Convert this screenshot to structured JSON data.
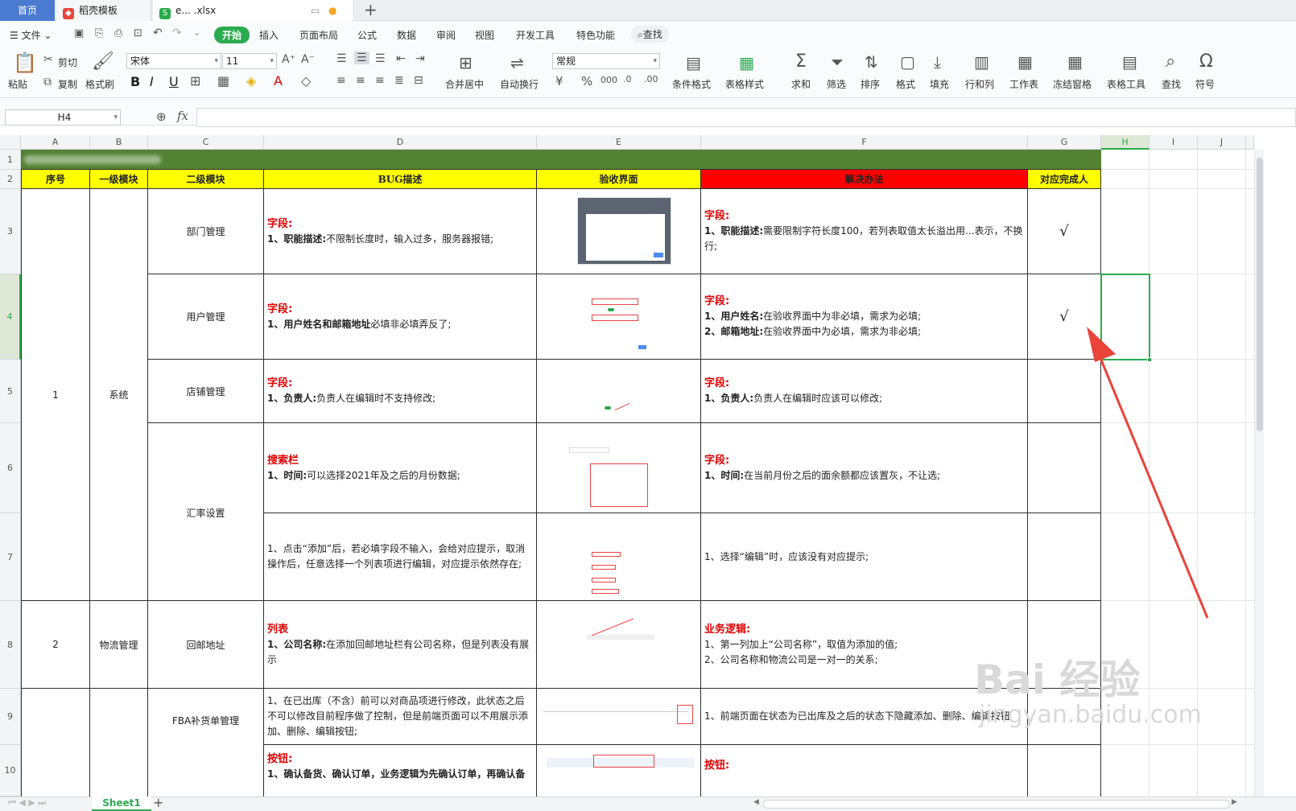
{
  "tabs": {
    "home": "首页",
    "template": "稻壳模板",
    "file": "e... .xlsx"
  },
  "menu": [
    "文件",
    "开始",
    "插入",
    "页面布局",
    "公式",
    "数据",
    "审阅",
    "视图",
    "开发工具",
    "特色功能",
    "查找"
  ],
  "ribbon": {
    "paste": "粘贴",
    "cut": "剪切",
    "copy": "复制",
    "format_painter": "格式刷",
    "font_name": "宋体",
    "font_size": "11",
    "merge": "合并居中",
    "wrap": "自动换行",
    "number_format": "常规",
    "cond_format": "条件格式",
    "table_style": "表格样式",
    "sum": "求和",
    "filter": "筛选",
    "sort": "排序",
    "format": "格式",
    "fill": "填充",
    "rowcol": "行和列",
    "worksheet": "工作表",
    "freeze": "冻结窗格",
    "table_tools": "表格工具",
    "find": "查找",
    "symbol": "符号"
  },
  "formula_bar": {
    "cell_ref": "H4",
    "fx": "fx",
    "value": ""
  },
  "columns": [
    "A",
    "B",
    "C",
    "D",
    "E",
    "F",
    "G",
    "H",
    "I",
    "J"
  ],
  "rows": [
    "1",
    "2",
    "3",
    "4",
    "5",
    "6",
    "7",
    "8",
    "9",
    "10"
  ],
  "sheet": {
    "headers": [
      "序号",
      "一级模块",
      "二级模块",
      "BUG描述",
      "验收界面",
      "解决办法",
      "对应完成人"
    ],
    "a_group1": "1",
    "b_group1": "系统",
    "a_group2": "2",
    "b_group2": "物流管理",
    "c3": "部门管理",
    "c4": "用户管理",
    "c5": "店铺管理",
    "c6": "汇率设置",
    "c8": "回邮地址",
    "c9": "FBA补货单管理",
    "d3_title": "字段:",
    "d3_key": "1、职能描述:",
    "d3_text": "不限制长度时，输入过多，服务器报错;",
    "f3_title": "字段:",
    "f3_key": "1、职能描述:",
    "f3_text": "需要限制字符长度100，若列表取值太长溢出用...表示，不换行;",
    "d4_title": "字段:",
    "d4_key": "1、用户姓名和邮箱地址",
    "d4_text": "必填非必填弄反了;",
    "f4_title": "字段:",
    "f4_key1": "1、用户姓名:",
    "f4_text1": "在验收界面中为非必填，需求为必填;",
    "f4_key2": "2、邮箱地址:",
    "f4_text2": "在验收界面中为必填，需求为非必填;",
    "d5_title": "字段:",
    "d5_key": "1、负责人:",
    "d5_text": "负责人在编辑时不支持修改;",
    "f5_title": "字段:",
    "f5_key": "1、负责人:",
    "f5_text": "负责人在编辑时应该可以修改;",
    "d6_title": "搜索栏",
    "d6_key": "1、时间:",
    "d6_text": "可以选择2021年及之后的月份数据;",
    "f6_title": "字段:",
    "f6_key": "1、时间:",
    "f6_text": "在当前月份之后的面余额都应该置灰，不让选;",
    "d7_text": "1、点击“添加”后，若必填字段不输入，会给对应提示，取消操作后，任意选择一个列表项进行编辑，对应提示依然存在;",
    "f7_text": "1、选择“编辑”时，应该没有对应提示;",
    "d8_title": "列表",
    "d8_key": "1、公司名称:",
    "d8_text": "在添加回邮地址栏有公司名称，但是列表没有展示",
    "f8_title": "业务逻辑:",
    "f8_text1": "1、第一列加上“公司名称”，取值为添加的值;",
    "f8_text2": "2、公司名称和物流公司是一对一的关系;",
    "d9_text": "1、在已出库（不含）前可以对商品项进行修改，此状态之后不可以修改目前程序做了控制，但是前端页面可以不用展示添加、删除、编辑按钮;",
    "f9_text": "1、前端页面在状态为已出库及之后的状态下隐藏添加、删除、编辑按钮",
    "d10_title": "按钮:",
    "d10_text": "1、确认备货、确认订单，业务逻辑为先确认订单，再确认备",
    "f10_title": "按钮:",
    "check_mark": "√"
  },
  "sheet_tab": "Sheet1",
  "watermark": {
    "line1": "Bai 经验",
    "line2": "jingyan.baidu.com"
  },
  "colors": {
    "header_fill": "#ffff00",
    "title_fill": "#548235",
    "red_fill": "#ff0000",
    "accent": "#2bab4f",
    "arrow": "#e8443a"
  }
}
